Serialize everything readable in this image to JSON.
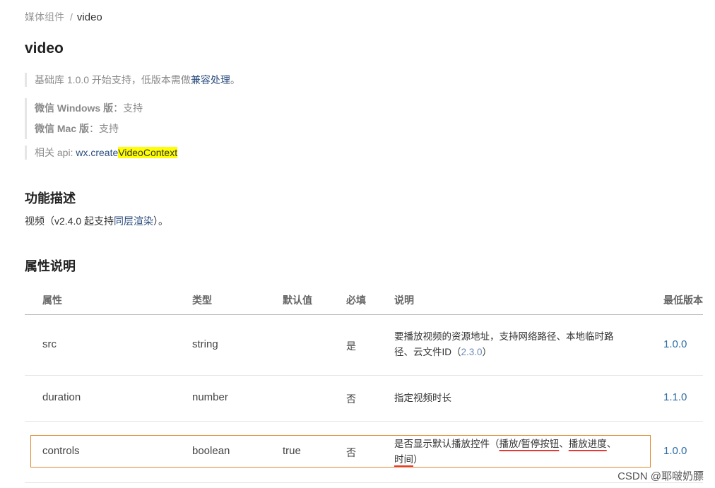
{
  "breadcrumb": {
    "parent": "媒体组件",
    "separator": "/",
    "current": "video"
  },
  "page_title": "video",
  "notes": {
    "base_lib_prefix": "基础库 1.0.0 开始支持，低版本需做",
    "base_lib_link": "兼容处理",
    "base_lib_suffix": "。",
    "windows_label": "微信 Windows 版",
    "windows_value": "：支持",
    "mac_label": "微信 Mac 版",
    "mac_value": "：支持",
    "api_prefix": "相关 api: ",
    "api_name_a": "wx.create",
    "api_name_b": "VideoContext"
  },
  "section_feature": {
    "title": "功能描述",
    "text_prefix": "视频（v2.4.0 起支持",
    "link": "同层渲染",
    "text_suffix": "）。"
  },
  "section_props": {
    "title": "属性说明",
    "columns": [
      "属性",
      "类型",
      "默认值",
      "必填",
      "说明",
      "最低版本"
    ],
    "rows": [
      {
        "name": "src",
        "type": "string",
        "default": "",
        "required": "是",
        "desc_line1": "要播放视频的资源地址，支持网络路径、本地临时路",
        "desc_line2_prefix": "径、云文件ID（",
        "desc_line2_ver": "2.3.0",
        "desc_line2_suffix": "）",
        "min_version": "1.0.0"
      },
      {
        "name": "duration",
        "type": "number",
        "default": "",
        "required": "否",
        "desc": "指定视频时长",
        "min_version": "1.1.0"
      },
      {
        "name": "controls",
        "type": "boolean",
        "default": "true",
        "required": "否",
        "desc_prefix": "是否显示默认播放控件（",
        "desc_u1": "播放/暂停按钮",
        "desc_sep1": "、",
        "desc_u2": "播放进度",
        "desc_sep2": "、",
        "desc_u3": "时间",
        "desc_suffix": "）",
        "min_version": "1.0.0"
      }
    ]
  },
  "watermark": "CSDN @耶啵奶膘"
}
